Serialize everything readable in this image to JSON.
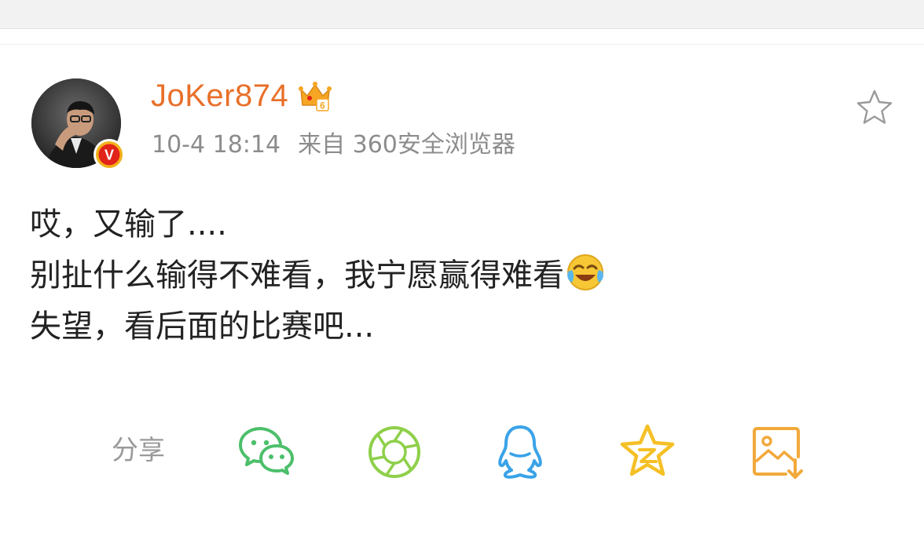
{
  "post": {
    "username": "JoKer874",
    "timestamp": "10-4 18:14",
    "source": "来自 360安全浏览器",
    "text_lines": [
      "哎，又输了....",
      "别扯什么输得不难看，我宁愿赢得难看",
      "失望，看后面的比赛吧..."
    ],
    "member_level": "6",
    "verified_badge": "V"
  },
  "share": {
    "label": "分享",
    "targets": [
      "wechat-icon",
      "moments-icon",
      "qq-icon",
      "qzone-icon",
      "save-image-icon"
    ]
  },
  "colors": {
    "username": "#e8702a",
    "meta": "#8c8c8c",
    "body_text": "#222222",
    "wechat": "#4cbf6b",
    "moments": "#8ed04a",
    "qq": "#3aa3e8",
    "qzone": "#f5c026",
    "save": "#f2a93b"
  }
}
